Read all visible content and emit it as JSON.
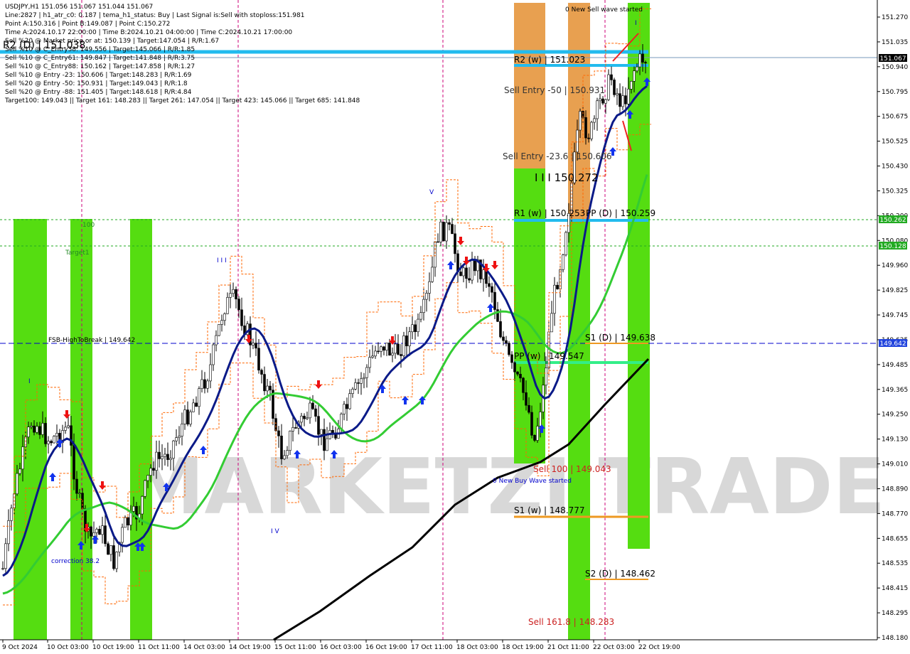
{
  "header": {
    "symbol_line": "USDJPY,H1  151.056 151.067 151.044 151.067",
    "info_lines": [
      "Line:2827 | h1_atr_c0: 0.187 | tema_h1_status: Buy | Last Signal is:Sell with stoploss:151.981",
      "Point A:150.316 | Point B:149.087 | Point C:150.272",
      "Time A:2024.10.17 22:00:00 | Time B:2024.10.21 04:00:00 | Time C:2024.10.21 17:00:00",
      "Sell %20 @ Market price or at: 150.139 | Target:147.054 | R/R:1.67",
      "Sell %10 @ C_Entry38: 149.556 | Target:145.066 | R/R:1.85",
      "Sell %10 @ C_Entry61: 149.847 | Target:141.848 | R/R:3.75",
      "Sell %10 @ C_Entry88: 150.162 | Target:147.858 | R/R:1.27",
      "Sell %10 @ Entry -23: 150.606 | Target:148.283 | R/R:1.69",
      "Sell %20 @ Entry -50: 150.931 | Target:149.043 | R/R:1.8",
      "Sell %20 @ Entry -88: 151.405 | Target:148.618 | R/R:4.84",
      "Target100: 149.043 || Target 161: 148.283 || Target 261: 147.054 || Target 423: 145.066 || Target 685: 141.848"
    ],
    "overlay_label": "R2 (D) | 151.038"
  },
  "price_axis": {
    "ticks": [
      "151.270",
      "151.035",
      "150.940",
      "150.795",
      "150.675",
      "150.525",
      "150.430",
      "150.325",
      "150.200",
      "150.080",
      "149.960",
      "149.825",
      "149.745",
      "149.625",
      "149.485",
      "149.365",
      "149.250",
      "149.130",
      "149.010",
      "148.890",
      "148.770",
      "148.655",
      "148.535",
      "148.415",
      "148.295",
      "148.180"
    ],
    "current_price": "151.067",
    "tag_150262": "150.262",
    "tag_150128": "150.128",
    "tag_149642": "149.642"
  },
  "time_axis": {
    "labels": [
      "9 Oct 2024",
      "10 Oct 03:00",
      "10 Oct 19:00",
      "11 Oct 11:00",
      "14 Oct 03:00",
      "14 Oct 19:00",
      "15 Oct 11:00",
      "16 Oct 03:00",
      "16 Oct 19:00",
      "17 Oct 11:00",
      "18 Oct 03:00",
      "18 Oct 19:00",
      "21 Oct 11:00",
      "22 Oct 03:00",
      "22 Oct 19:00"
    ]
  },
  "annotations": {
    "new_sell_wave": "0 New Sell wave started",
    "new_buy_wave": "0 New Buy Wave started",
    "r2_w": "R2 (w) | 151.023",
    "sell_entry_50": "Sell Entry -50 | 150.931",
    "sell_entry_236": "Sell Entry -23.6 | 150.606",
    "c_marker": "I I I 150.272",
    "r1_w": "R1 (w) | 150.253",
    "pp_d": "PP (D) | 150.259",
    "s1_d": "S1 (D) | 149.638",
    "pp_w": "PP (w) | 149.547",
    "sell100": "Sell 100 | 149.043",
    "s1_w": "S1 (w) | 148.777",
    "s2_d": "S2 (D) | 148.462",
    "sell1618": "Sell 161.8 | 148.283",
    "fsb": "FSB-HighToBreak | 149.642",
    "label_100": "100",
    "target1": "Target1",
    "correction": "correction 38.2",
    "wave_iii": "I I I",
    "wave_iv": "I V",
    "wave_v": "V",
    "wave_i_top": "I",
    "wave_i_left": "I",
    "watermark": "MARKETZI TRADE"
  },
  "colors": {
    "green_band": "#55dd11",
    "orange_band": "#e8a050",
    "cyan": "#22bbee",
    "navy": "#0a1a88",
    "green_ma": "#33cc33",
    "black_ma": "#000000",
    "orange_dash": "#ff6600",
    "magenta": "#cc0077",
    "blue_dash": "#0000cc"
  }
}
